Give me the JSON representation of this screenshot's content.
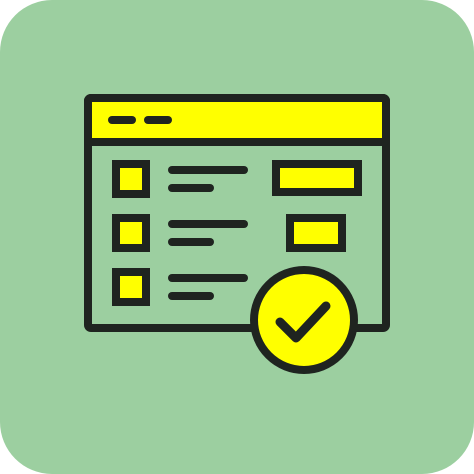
{
  "icon": {
    "name": "checklist-window-approved-icon",
    "colors": {
      "tile_background": "#9ccfa0",
      "outline": "#1f2420",
      "accent_fill": "#ffff00",
      "window_body": "#9ccfa0"
    },
    "checklist_rows": 3,
    "badge": "checkmark-circle"
  }
}
